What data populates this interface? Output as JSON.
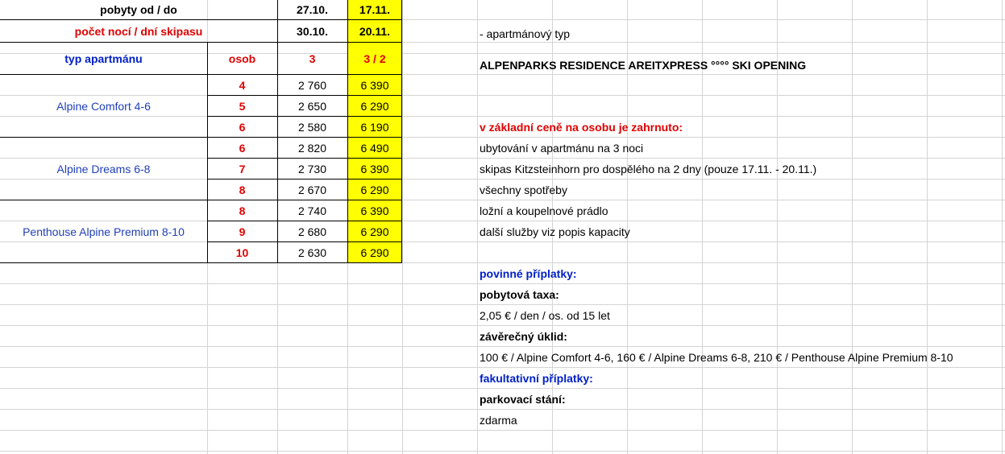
{
  "header": {
    "row1_label": "pobyty od / do",
    "row1_date_a": "27.10.",
    "row1_date_b": "17.11.",
    "row2_label": "počet nocí / dní skipasu",
    "row2_date_a": "30.10.",
    "row2_date_b": "20.11.",
    "col_type": "typ apartmánu",
    "col_persons": "osob",
    "col_a": "3",
    "col_b": "3 / 2"
  },
  "apartments": [
    {
      "name": "Alpine Comfort 4-6",
      "rows": [
        {
          "persons": "4",
          "price_a": "2 760",
          "price_b": "6 390"
        },
        {
          "persons": "5",
          "price_a": "2 650",
          "price_b": "6 290"
        },
        {
          "persons": "6",
          "price_a": "2 580",
          "price_b": "6 190"
        }
      ]
    },
    {
      "name": "Alpine Dreams 6-8",
      "rows": [
        {
          "persons": "6",
          "price_a": "2 820",
          "price_b": "6 490"
        },
        {
          "persons": "7",
          "price_a": "2 730",
          "price_b": "6 390"
        },
        {
          "persons": "8",
          "price_a": "2 670",
          "price_b": "6 290"
        }
      ]
    },
    {
      "name": "Penthouse Alpine Premium 8-10",
      "rows": [
        {
          "persons": "8",
          "price_a": "2 740",
          "price_b": "6 390"
        },
        {
          "persons": "9",
          "price_a": "2 680",
          "price_b": "6 290"
        },
        {
          "persons": "10",
          "price_a": "2 630",
          "price_b": "6 290"
        }
      ]
    }
  ],
  "notes": {
    "type_note": " - apartmánový typ",
    "title": "ALPENPARKS RESIDENCE AREITXPRESS °°°° SKI OPENING",
    "included_heading": "v základní ceně na osobu je zahrnuto:",
    "included_1": "ubytování v apartmánu na 3 noci",
    "included_2": "skipas Kitzsteinhorn pro dospělého na 2 dny (pouze 17.11. - 20.11.)",
    "included_3": "všechny spotřeby",
    "included_4": "ložní a koupelnové prádlo",
    "included_5": "další služby viz popis kapacity",
    "mandatory_heading": "povinné příplatky:",
    "tax_label": "pobytová taxa:",
    "tax_value": "2,05 € / den / os. od 15 let",
    "cleaning_label": "závěrečný úklid:",
    "cleaning_value": "100 € / Alpine Comfort 4-6, 160 € / Alpine Dreams 6-8, 210 € / Penthouse Alpine Premium 8-10",
    "optional_heading": "fakultativní příplatky:",
    "parking_label": "parkovací stání:",
    "parking_value": "zdarma"
  },
  "colors": {
    "highlight": "#ffff00",
    "red": "#e00000",
    "blue": "#0020c8",
    "grid": "#d4d4d4"
  }
}
